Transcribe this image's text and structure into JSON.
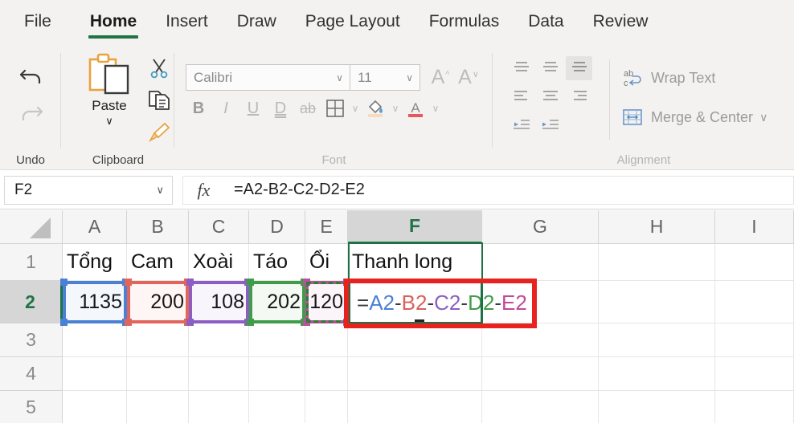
{
  "ribbon": {
    "tabs": [
      {
        "label": "File",
        "active": false
      },
      {
        "label": "Home",
        "active": true
      },
      {
        "label": "Insert",
        "active": false
      },
      {
        "label": "Draw",
        "active": false
      },
      {
        "label": "Page Layout",
        "active": false
      },
      {
        "label": "Formulas",
        "active": false
      },
      {
        "label": "Data",
        "active": false
      },
      {
        "label": "Review",
        "active": false
      }
    ],
    "groups": {
      "undo": {
        "label": "Undo",
        "undo_icon": "undo-arrow-icon",
        "redo_icon": "redo-arrow-icon"
      },
      "clipboard": {
        "label": "Clipboard",
        "paste_label": "Paste",
        "paste_caret": "∨",
        "paste_icon": "paste-clipboard-icon",
        "cut_icon": "scissors-icon",
        "copy_icon": "copy-pages-icon",
        "format_painter_icon": "format-painter-brush-icon"
      },
      "font": {
        "label": "Font",
        "font_name": "Calibri",
        "font_size": "11",
        "caret": "∨",
        "grow_label": "A",
        "shrink_label": "A",
        "bold": "B",
        "italic": "I",
        "underline": "U",
        "double_underline": "D",
        "strikethrough": "ab",
        "borders_icon": "borders-grid-icon",
        "fill_color_icon": "fill-color-bucket-icon",
        "font_color_icon": "font-color-a-icon"
      },
      "alignment": {
        "label": "Alignment",
        "align_top_icon": "align-top-icon",
        "align_middle_icon": "align-middle-icon",
        "align_bottom_icon": "align-bottom-icon",
        "align_left_icon": "align-left-icon",
        "align_center_icon": "align-center-icon",
        "align_right_icon": "align-right-icon",
        "decrease_indent_icon": "decrease-indent-icon",
        "increase_indent_icon": "increase-indent-icon",
        "wrap_text_label": "Wrap Text",
        "wrap_text_icon": "wrap-text-icon",
        "merge_center_label": "Merge & Center",
        "merge_center_icon": "merge-cells-icon",
        "merge_center_caret": "∨"
      }
    }
  },
  "formula_bar": {
    "name_box_value": "F2",
    "name_box_caret": "∨",
    "fx_label": "fx",
    "formula": "=A2-B2-C2-D2-E2"
  },
  "sheet": {
    "column_headers": [
      "A",
      "B",
      "C",
      "D",
      "E",
      "F",
      "G",
      "H",
      "I"
    ],
    "selected_column": "F",
    "row_headers": [
      "1",
      "2",
      "3",
      "4",
      "5"
    ],
    "selected_row": "2",
    "rows": [
      {
        "row": "1",
        "cells": [
          "Tổng",
          "Cam",
          "Xoài",
          "Táo",
          "Ổi",
          "Thanh long",
          "",
          "",
          ""
        ]
      },
      {
        "row": "2",
        "cells": [
          "1135",
          "200",
          "108",
          "202",
          "120",
          "",
          "",
          "",
          ""
        ]
      },
      {
        "row": "3",
        "cells": [
          "",
          "",
          "",
          "",
          "",
          "",
          "",
          "",
          ""
        ]
      },
      {
        "row": "4",
        "cells": [
          "",
          "",
          "",
          "",
          "",
          "",
          "",
          "",
          ""
        ]
      },
      {
        "row": "5",
        "cells": [
          "",
          "",
          "",
          "",
          "",
          "",
          "",
          "",
          ""
        ]
      }
    ],
    "editing_cell": "F2",
    "editing_tokens": [
      {
        "text": "=",
        "color": "#3a3a3a"
      },
      {
        "text": "A2",
        "color": "#4a81d4"
      },
      {
        "text": "-",
        "color": "#3a3a3a"
      },
      {
        "text": "B2",
        "color": "#d9625a"
      },
      {
        "text": "-",
        "color": "#3a3a3a"
      },
      {
        "text": "C2",
        "color": "#8c5ec4"
      },
      {
        "text": "-",
        "color": "#3a3a3a"
      },
      {
        "text": "D2",
        "color": "#3f9d4a"
      },
      {
        "text": "-",
        "color": "#3a3a3a"
      },
      {
        "text": "E2",
        "color": "#c0499c"
      }
    ],
    "precedent_highlights": [
      {
        "ref": "A2",
        "color": "#4a81d4"
      },
      {
        "ref": "B2",
        "color": "#e2655c"
      },
      {
        "ref": "C2",
        "color": "#8c5ec4"
      },
      {
        "ref": "D2",
        "color": "#3f9d4a"
      },
      {
        "ref": "E2",
        "color": "#b5539b"
      }
    ],
    "marching_ants_cell": "E2",
    "marching_ants_color": "#2e7d32",
    "callout_box": {
      "around": "F2",
      "color": "#e8231f"
    }
  },
  "colors": {
    "accent_green": "#217346",
    "ribbon_bg": "#f3f2f1",
    "grid_line": "#e6e6e6",
    "header_bg": "#f5f5f5"
  }
}
